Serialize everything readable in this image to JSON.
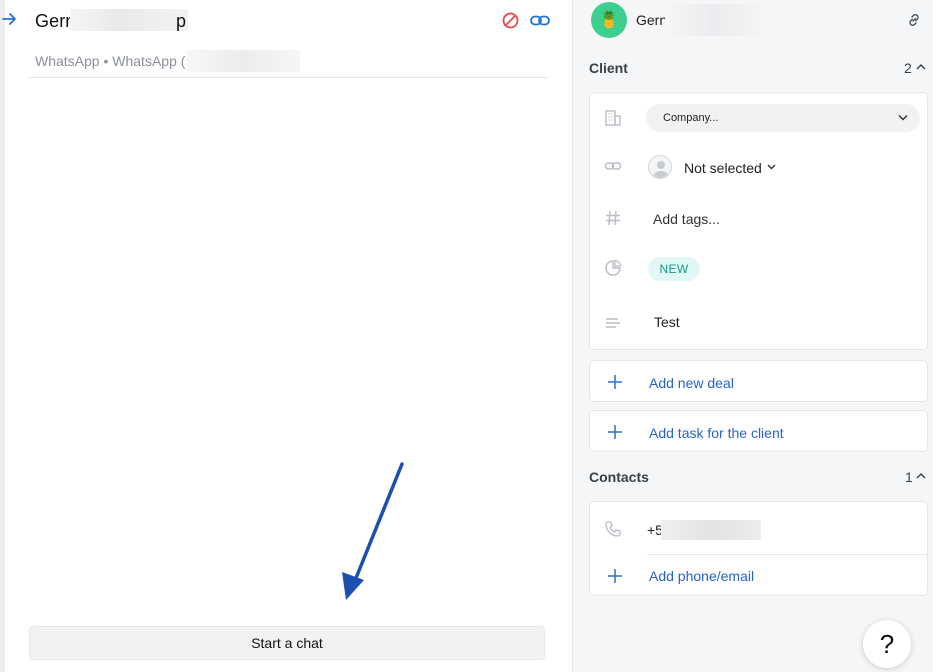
{
  "chat": {
    "title": "Gern",
    "title_tail": "p",
    "subtitle": "WhatsApp • WhatsApp (",
    "start_button": "Start a chat"
  },
  "sidebar": {
    "contact_name": "Gern",
    "avatar_emoji": "🍍",
    "client_section": {
      "title": "Client",
      "count": "2",
      "company_placeholder": "Company...",
      "responsible": "Not selected",
      "tags_placeholder": "Add tags...",
      "status": "NEW",
      "note": "Test"
    },
    "add_deal": "Add new deal",
    "add_task": "Add task for the client",
    "contacts_section": {
      "title": "Contacts",
      "count": "1",
      "phone_prefix": "+5",
      "add_contact": "Add phone/email"
    },
    "help_label": "?"
  },
  "colors": {
    "accent_blue": "#2563c9",
    "danger_red": "#e5484d",
    "status_bg": "#e2f8f6",
    "status_text": "#0c9a8b",
    "avatar_bg": "#3ecf8e",
    "annotation_arrow": "#1c4fb0"
  },
  "icons": {
    "back": "arrow-right-icon",
    "block": "block-icon",
    "link": "link-icon",
    "company": "building-icon",
    "responsible": "link-icon",
    "tags": "hash-icon",
    "status": "pie-icon",
    "note": "lines-icon",
    "phone": "phone-icon",
    "add": "plus-icon",
    "help": "question-icon"
  }
}
